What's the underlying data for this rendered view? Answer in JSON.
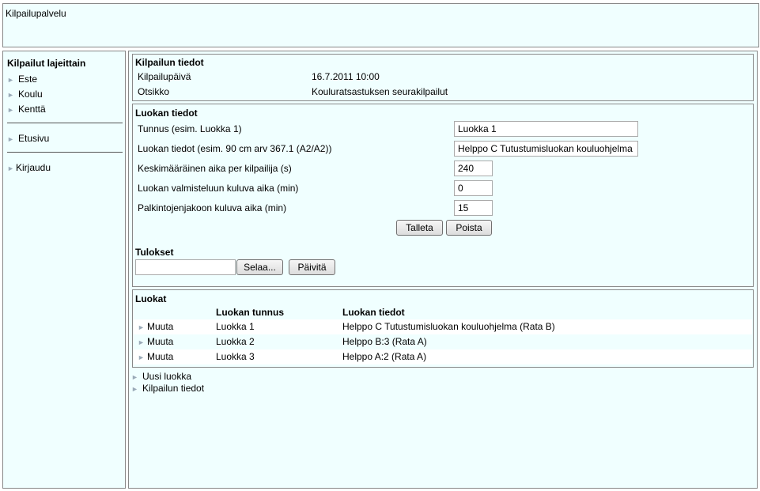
{
  "header": {
    "title": "Kilpailupalvelu"
  },
  "sidebar": {
    "heading": "Kilpailut lajeittain",
    "sports": [
      "Este",
      "Koulu",
      "Kenttä"
    ],
    "home": "Etusivu",
    "login": "Kirjaudu"
  },
  "competition": {
    "heading": "Kilpailun tiedot",
    "date_label": "Kilpailupäivä",
    "date_value": "16.7.2011 10:00",
    "title_label": "Otsikko",
    "title_value": "Kouluratsastuksen seurakilpailut"
  },
  "class_form": {
    "heading": "Luokan tiedot",
    "fields": [
      {
        "label": "Tunnus (esim. Luokka 1)",
        "value": "Luokka 1"
      },
      {
        "label": "Luokan tiedot (esim. 90 cm arv 367.1 (A2/A2))",
        "value": "Helppo C Tutustumisluokan kouluohjelma (Rata B)"
      },
      {
        "label": "Keskimääräinen aika per kilpailija (s)",
        "value": "240"
      },
      {
        "label": "Luokan valmisteluun kuluva aika (min)",
        "value": "0"
      },
      {
        "label": "Palkintojenjakoon kuluva aika (min)",
        "value": "15"
      }
    ],
    "save_label": "Talleta",
    "delete_label": "Poista",
    "results_heading": "Tulokset",
    "browse_label": "Selaa...",
    "update_label": "Päivitä"
  },
  "classes": {
    "heading": "Luokat",
    "col_id": "Luokan tunnus",
    "col_info": "Luokan tiedot",
    "rows": [
      {
        "action": "Muuta",
        "id": "Luokka 1",
        "info": "Helppo C Tutustumisluokan kouluohjelma (Rata B)"
      },
      {
        "action": "Muuta",
        "id": "Luokka 2",
        "info": "Helppo B:3 (Rata A)"
      },
      {
        "action": "Muuta",
        "id": "Luokka 3",
        "info": "Helppo A:2 (Rata A)"
      }
    ]
  },
  "links": {
    "new_class": "Uusi luokka",
    "competition_info": "Kilpailun tiedot"
  }
}
